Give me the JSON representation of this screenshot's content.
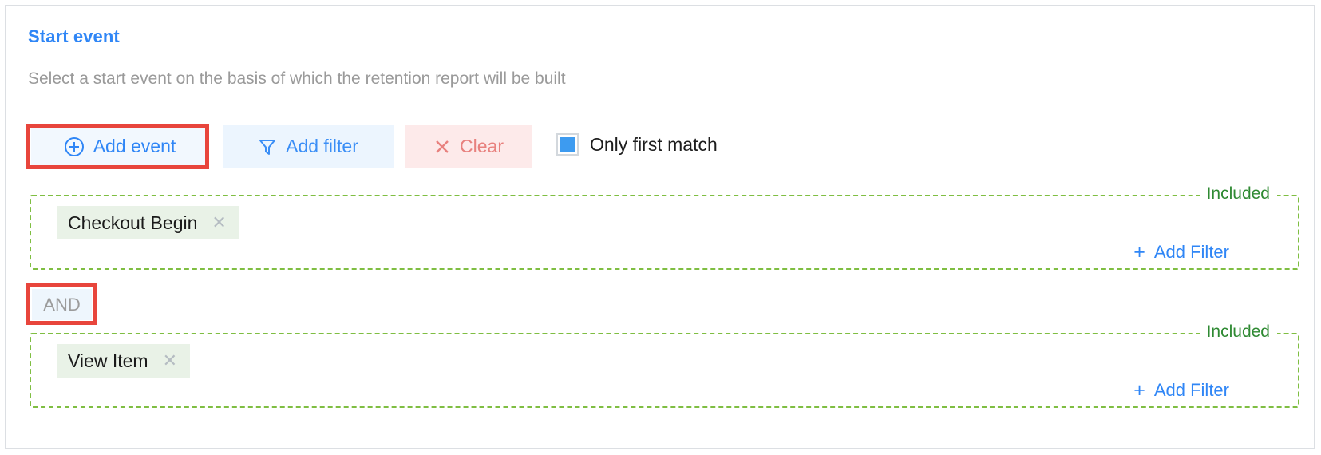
{
  "panel": {
    "title": "Start event",
    "description": "Select a start event on the basis of which the retention report will be built"
  },
  "toolbar": {
    "add_event_label": "Add event",
    "add_event_icon": "plus-circle-icon",
    "add_filter_label": "Add filter",
    "add_filter_icon": "funnel-icon",
    "clear_label": "Clear",
    "clear_icon": "close-x-icon"
  },
  "only_first_match": {
    "label": "Only first match",
    "checked": true
  },
  "connector": {
    "label": "AND"
  },
  "groups": [
    {
      "legend": "Included",
      "event_label": "Checkout Begin",
      "remove_icon": "close-x-icon",
      "add_filter_label": "Add Filter",
      "add_filter_icon": "plus-icon"
    },
    {
      "legend": "Included",
      "event_label": "View Item",
      "remove_icon": "close-x-icon",
      "add_filter_label": "Add Filter",
      "add_filter_icon": "plus-icon"
    }
  ],
  "colors": {
    "accent_blue": "#2f86f6",
    "green_border": "#7fbe42",
    "green_legend": "#2f8a33",
    "clear_red": "#e8817e",
    "highlight_red": "#e8453c",
    "tag_bg": "#e9f2e7",
    "checkbox_blue": "#3d9bf0"
  }
}
